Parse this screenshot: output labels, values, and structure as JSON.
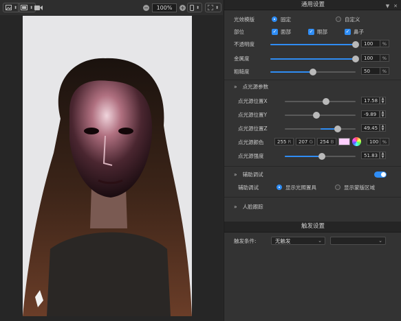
{
  "toolbar": {
    "zoom": "100%"
  },
  "panel": {
    "general_title": "通用设置",
    "light_effect": {
      "label": "光效模版",
      "options": [
        "固定",
        "自定义"
      ],
      "selected": 0
    },
    "parts": {
      "label": "部位",
      "items": [
        "面部",
        "眼部",
        "鼻子"
      ]
    },
    "opacity": {
      "label": "不透明度",
      "value": "100",
      "unit": "%",
      "level": 1.0
    },
    "metallic": {
      "label": "金属度",
      "value": "100",
      "unit": "%",
      "level": 1.0
    },
    "roughness": {
      "label": "粗糙度",
      "value": "50",
      "unit": "%",
      "level": 0.5
    },
    "point_light": {
      "title": "点光源参数",
      "pos_x": {
        "label": "点光源位置X",
        "value": "17.58",
        "level": 0.58
      },
      "pos_y": {
        "label": "点光源位置Y",
        "value": "-9.89",
        "level": 0.45
      },
      "pos_z": {
        "label": "点光源位置Z",
        "value": "49.45",
        "level": 0.75
      },
      "color": {
        "label": "点光源颜色",
        "r": "255",
        "r_unit": "R",
        "g": "207",
        "g_unit": "G",
        "b": "254",
        "b_unit": "B",
        "alpha": "100",
        "alpha_unit": "%",
        "swatch": "#ffcffe"
      },
      "intensity": {
        "label": "点光源强度",
        "value": "51.83",
        "unit": "%",
        "level": 0.52
      }
    },
    "debug": {
      "title": "辅助调试",
      "mode_label": "辅助调试",
      "options": [
        "显示光照置具",
        "显示蒙版区域"
      ],
      "selected": 0
    },
    "face_tracking": {
      "title": "人脸跟踪"
    },
    "trigger": {
      "title": "触发设置",
      "condition_label": "触发条件:",
      "condition_value": "无触发",
      "second_value": ""
    }
  },
  "colors": {
    "accent": "#2f8df5"
  }
}
